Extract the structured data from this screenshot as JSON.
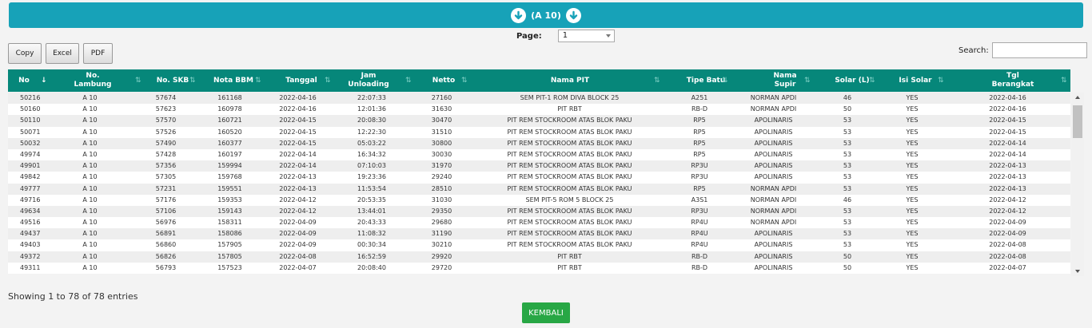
{
  "banner": {
    "title": "(A 10)"
  },
  "pager": {
    "label": "Page:",
    "selected": "1"
  },
  "buttons": {
    "copy": "Copy",
    "excel": "Excel",
    "pdf": "PDF"
  },
  "search": {
    "label": "Search:",
    "value": ""
  },
  "table": {
    "headers": [
      "No",
      "No. Lambung",
      "No. SKB",
      "Nota BBM",
      "Tanggal",
      "Jam Unloading",
      "Netto",
      "Nama PIT",
      "Tipe Batu",
      "Nama Supir",
      "Solar (L)",
      "Isi Solar",
      "Tgl Berangkat"
    ],
    "rows": [
      [
        "50216",
        "A 10",
        "57674",
        "161168",
        "2022-04-16",
        "22:07:33",
        "27160",
        "SEM PIT-1 ROM DIVA BLOCK 25",
        "A251",
        "NORMAN APDI",
        "46",
        "YES",
        "2022-04-16"
      ],
      [
        "50160",
        "A 10",
        "57623",
        "160978",
        "2022-04-16",
        "12:01:36",
        "31630",
        "PIT RBT",
        "RB-D",
        "NORMAN APDI",
        "50",
        "YES",
        "2022-04-16"
      ],
      [
        "50110",
        "A 10",
        "57570",
        "160721",
        "2022-04-15",
        "20:08:30",
        "30470",
        "PIT REM STOCKROOM ATAS BLOK PAKU",
        "RP5",
        "APOLINARIS",
        "53",
        "YES",
        "2022-04-15"
      ],
      [
        "50071",
        "A 10",
        "57526",
        "160520",
        "2022-04-15",
        "12:22:30",
        "31510",
        "PIT REM STOCKROOM ATAS BLOK PAKU",
        "RP5",
        "APOLINARIS",
        "53",
        "YES",
        "2022-04-15"
      ],
      [
        "50032",
        "A 10",
        "57490",
        "160377",
        "2022-04-15",
        "05:03:22",
        "30800",
        "PIT REM STOCKROOM ATAS BLOK PAKU",
        "RP5",
        "APOLINARIS",
        "53",
        "YES",
        "2022-04-14"
      ],
      [
        "49974",
        "A 10",
        "57428",
        "160197",
        "2022-04-14",
        "16:34:32",
        "30030",
        "PIT REM STOCKROOM ATAS BLOK PAKU",
        "RP5",
        "APOLINARIS",
        "53",
        "YES",
        "2022-04-14"
      ],
      [
        "49901",
        "A 10",
        "57356",
        "159994",
        "2022-04-14",
        "07:10:03",
        "31970",
        "PIT REM STOCKROOM ATAS BLOK PAKU",
        "RP3U",
        "APOLINARIS",
        "53",
        "YES",
        "2022-04-13"
      ],
      [
        "49842",
        "A 10",
        "57305",
        "159768",
        "2022-04-13",
        "19:23:36",
        "29240",
        "PIT REM STOCKROOM ATAS BLOK PAKU",
        "RP3U",
        "APOLINARIS",
        "53",
        "YES",
        "2022-04-13"
      ],
      [
        "49777",
        "A 10",
        "57231",
        "159551",
        "2022-04-13",
        "11:53:54",
        "28510",
        "PIT REM STOCKROOM ATAS BLOK PAKU",
        "RP5",
        "NORMAN APDI",
        "53",
        "YES",
        "2022-04-13"
      ],
      [
        "49716",
        "A 10",
        "57176",
        "159353",
        "2022-04-12",
        "20:53:35",
        "31030",
        "SEM PIT-5 ROM 5 BLOCK 25",
        "A3S1",
        "NORMAN APDI",
        "46",
        "YES",
        "2022-04-12"
      ],
      [
        "49634",
        "A 10",
        "57106",
        "159143",
        "2022-04-12",
        "13:44:01",
        "29350",
        "PIT REM STOCKROOM ATAS BLOK PAKU",
        "RP3U",
        "NORMAN APDI",
        "53",
        "YES",
        "2022-04-12"
      ],
      [
        "49516",
        "A 10",
        "56976",
        "158311",
        "2022-04-09",
        "20:43:33",
        "29680",
        "PIT REM STOCKROOM ATAS BLOK PAKU",
        "RP4U",
        "NORMAN APDI",
        "53",
        "YES",
        "2022-04-09"
      ],
      [
        "49437",
        "A 10",
        "56891",
        "158086",
        "2022-04-09",
        "11:08:32",
        "31190",
        "PIT REM STOCKROOM ATAS BLOK PAKU",
        "RP4U",
        "APOLINARIS",
        "53",
        "YES",
        "2022-04-09"
      ],
      [
        "49403",
        "A 10",
        "56860",
        "157905",
        "2022-04-09",
        "00:30:34",
        "30210",
        "PIT REM STOCKROOM ATAS BLOK PAKU",
        "RP4U",
        "APOLINARIS",
        "53",
        "YES",
        "2022-04-08"
      ],
      [
        "49372",
        "A 10",
        "56826",
        "157805",
        "2022-04-08",
        "16:52:59",
        "29920",
        "PIT RBT",
        "RB-D",
        "APOLINARIS",
        "50",
        "YES",
        "2022-04-08"
      ],
      [
        "49311",
        "A 10",
        "56793",
        "157523",
        "2022-04-07",
        "20:08:40",
        "29720",
        "PIT RBT",
        "RB-D",
        "APOLINARIS",
        "50",
        "YES",
        "2022-04-07"
      ]
    ]
  },
  "info": "Showing 1 to 78 of 78 entries",
  "kembali": "KEMBALI",
  "colors": {
    "banner": "#17a2b8",
    "header": "#06877a",
    "kembali": "#28a745"
  },
  "icons": {
    "banner": "arrow-circle-down-icon",
    "sort": "sort-icon",
    "select": "caret-down-icon"
  }
}
